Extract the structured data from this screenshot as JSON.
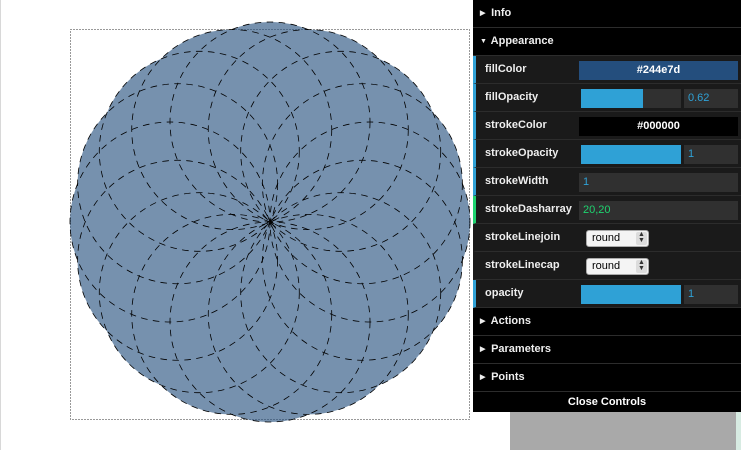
{
  "controls": {
    "folders": {
      "info": "Info",
      "appearance": "Appearance",
      "actions": "Actions",
      "parameters": "Parameters",
      "points": "Points"
    },
    "fill_color": {
      "label": "fillColor",
      "value": "#244e7d",
      "bg": "#244e7d"
    },
    "fill_opacity": {
      "label": "fillOpacity",
      "value": "0.62",
      "fraction": 0.62
    },
    "stroke_color": {
      "label": "strokeColor",
      "value": "#000000",
      "bg": "#000000"
    },
    "stroke_opacity": {
      "label": "strokeOpacity",
      "value": "1",
      "fraction": 1
    },
    "stroke_width": {
      "label": "strokeWidth",
      "value": "1"
    },
    "stroke_dasharray": {
      "label": "strokeDasharray",
      "value": "20,20"
    },
    "stroke_linejoin": {
      "label": "strokeLinejoin",
      "value": "round"
    },
    "stroke_linecap": {
      "label": "strokeLinecap",
      "value": "round"
    },
    "opacity": {
      "label": "opacity",
      "value": "1",
      "fraction": 1
    },
    "close_label": "Close Controls"
  },
  "shape": {
    "fill": "#244e7d",
    "fill_opacity": 0.62,
    "stroke": "#000000",
    "dash": "6,6",
    "petals": 16
  }
}
